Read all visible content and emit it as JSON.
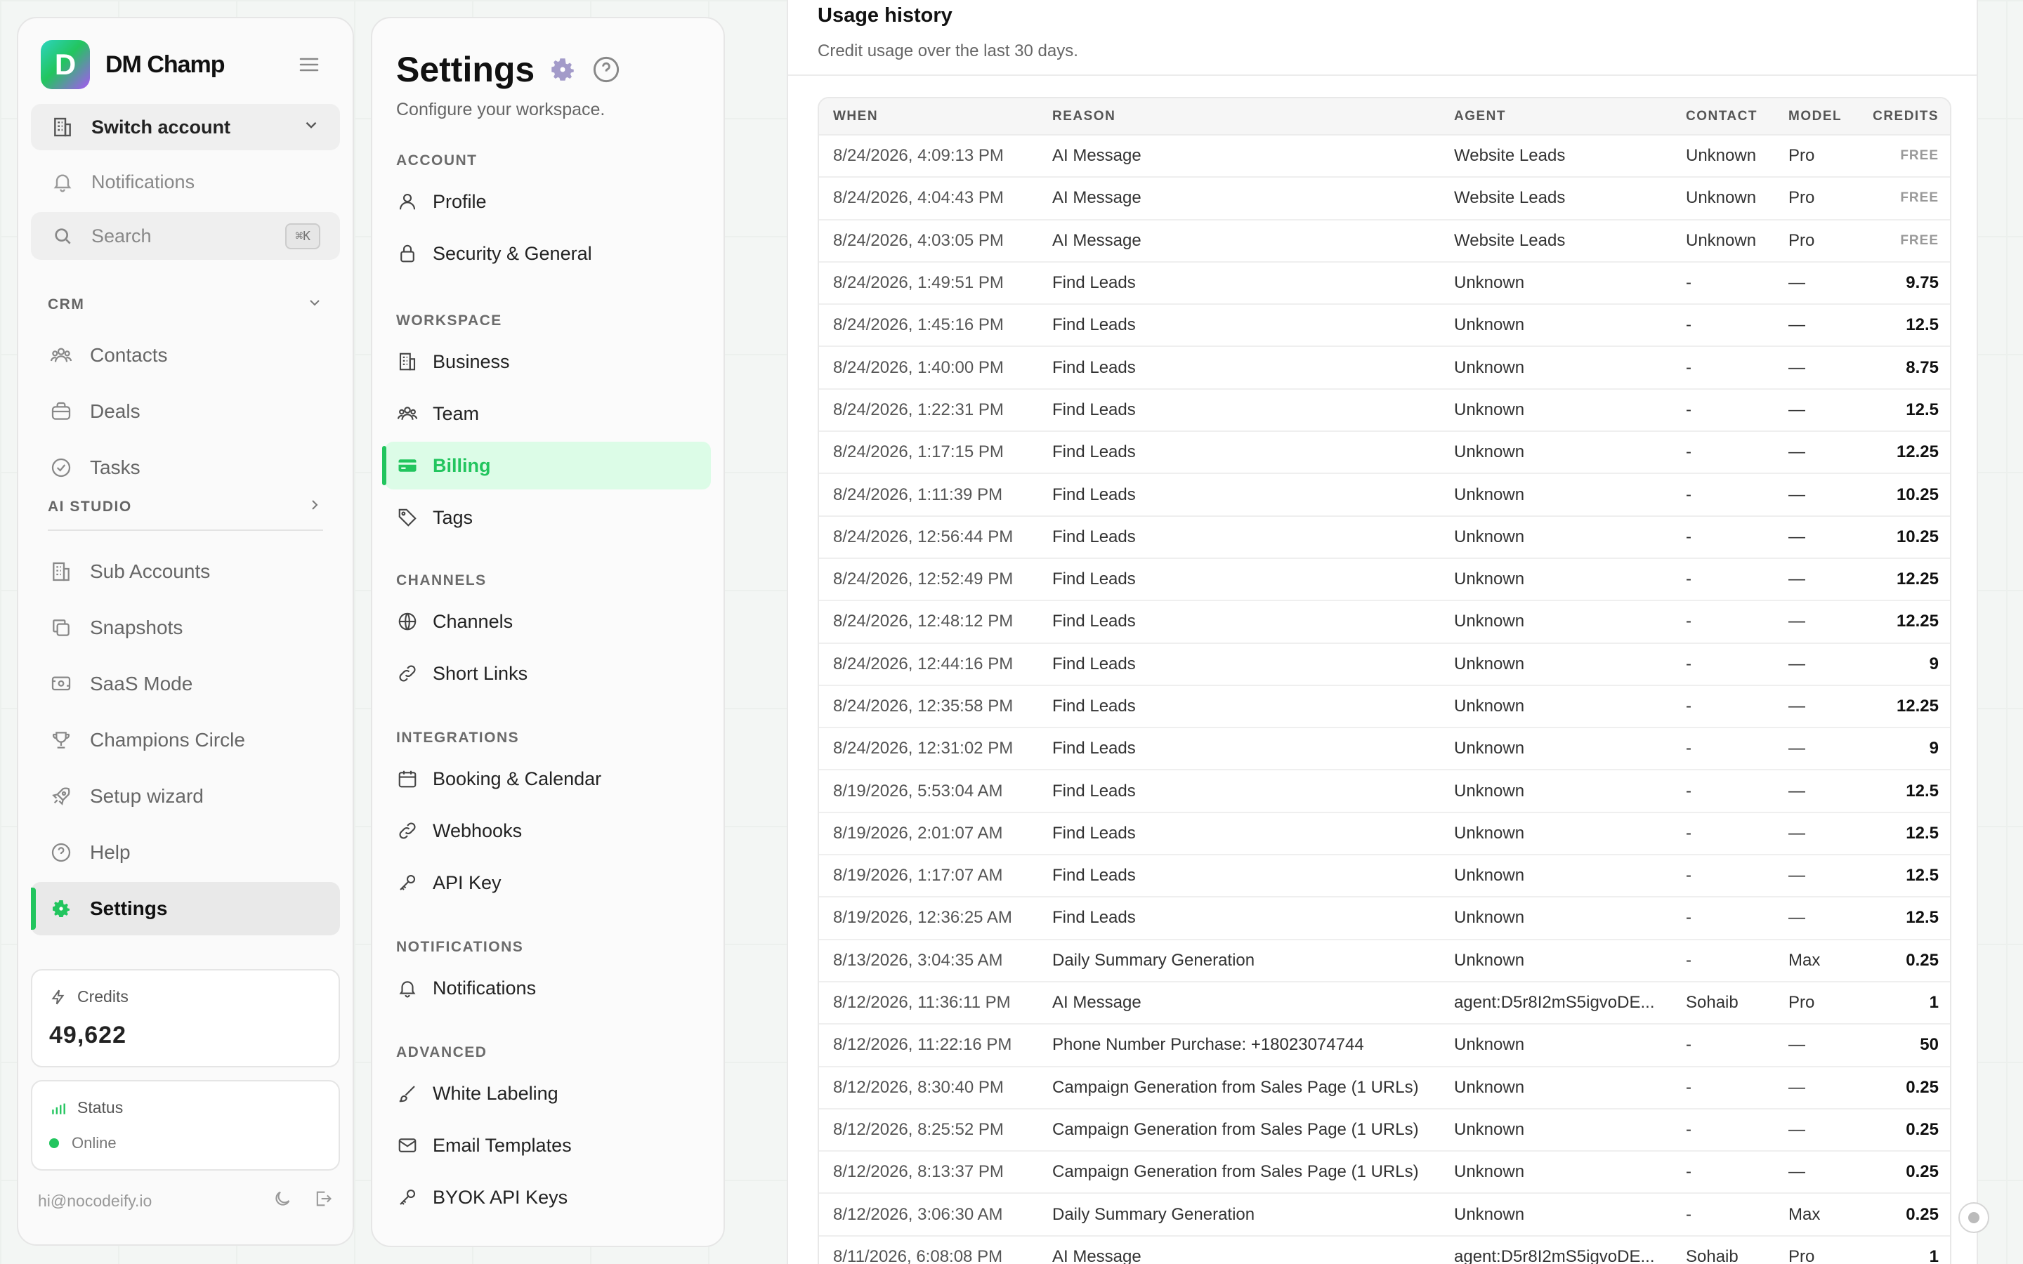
{
  "brand": {
    "name": "DM Champ",
    "logo_letter": "D"
  },
  "sidebar": {
    "switch_account": "Switch account",
    "notifications": "Notifications",
    "search_placeholder": "Search",
    "search_shortcut": "⌘K",
    "crm_label": "CRM",
    "crm_items": [
      {
        "label": "Contacts",
        "icon": "users-icon"
      },
      {
        "label": "Deals",
        "icon": "briefcase-icon"
      },
      {
        "label": "Tasks",
        "icon": "check-circle-icon"
      }
    ],
    "ai_studio_label": "AI STUDIO",
    "items": [
      {
        "label": "Sub Accounts",
        "icon": "building-icon"
      },
      {
        "label": "Snapshots",
        "icon": "copy-icon"
      },
      {
        "label": "SaaS Mode",
        "icon": "monitor-icon"
      },
      {
        "label": "Champions Circle",
        "icon": "trophy-icon"
      },
      {
        "label": "Setup wizard",
        "icon": "rocket-icon"
      },
      {
        "label": "Help",
        "icon": "help-circle-icon"
      },
      {
        "label": "Settings",
        "icon": "gear-icon",
        "active": true
      }
    ],
    "credits_label": "Credits",
    "credits_value": "49,622",
    "status_label": "Status",
    "status_value": "Online",
    "user_email": "hi@nocodeify.io"
  },
  "settings": {
    "title": "Settings",
    "subtitle": "Configure your workspace.",
    "groups": [
      {
        "label": "ACCOUNT",
        "items": [
          {
            "label": "Profile",
            "icon": "user-icon"
          },
          {
            "label": "Security & General",
            "icon": "lock-icon"
          }
        ]
      },
      {
        "label": "WORKSPACE",
        "items": [
          {
            "label": "Business",
            "icon": "building-icon"
          },
          {
            "label": "Team",
            "icon": "users-icon"
          },
          {
            "label": "Billing",
            "icon": "credit-card-icon",
            "active": true
          },
          {
            "label": "Tags",
            "icon": "tag-icon"
          }
        ]
      },
      {
        "label": "CHANNELS",
        "items": [
          {
            "label": "Channels",
            "icon": "globe-icon"
          },
          {
            "label": "Short Links",
            "icon": "link-icon"
          }
        ]
      },
      {
        "label": "INTEGRATIONS",
        "items": [
          {
            "label": "Booking & Calendar",
            "icon": "calendar-icon"
          },
          {
            "label": "Webhooks",
            "icon": "link-icon"
          },
          {
            "label": "API Key",
            "icon": "key-icon"
          }
        ]
      },
      {
        "label": "NOTIFICATIONS",
        "items": [
          {
            "label": "Notifications",
            "icon": "bell-icon"
          }
        ]
      },
      {
        "label": "ADVANCED",
        "items": [
          {
            "label": "White Labeling",
            "icon": "brush-icon"
          },
          {
            "label": "Email Templates",
            "icon": "mail-icon"
          },
          {
            "label": "BYOK API Keys",
            "icon": "key-icon"
          }
        ]
      }
    ]
  },
  "usage": {
    "title": "Usage history",
    "subtitle": "Credit usage over the last 30 days.",
    "columns": [
      "WHEN",
      "REASON",
      "AGENT",
      "CONTACT",
      "MODEL",
      "CREDITS"
    ],
    "rows": [
      [
        "8/24/2026, 4:09:13 PM",
        "AI Message",
        "Website Leads",
        "Unknown",
        "Pro",
        "FREE"
      ],
      [
        "8/24/2026, 4:04:43 PM",
        "AI Message",
        "Website Leads",
        "Unknown",
        "Pro",
        "FREE"
      ],
      [
        "8/24/2026, 4:03:05 PM",
        "AI Message",
        "Website Leads",
        "Unknown",
        "Pro",
        "FREE"
      ],
      [
        "8/24/2026, 1:49:51 PM",
        "Find Leads",
        "Unknown",
        "-",
        "—",
        "9.75"
      ],
      [
        "8/24/2026, 1:45:16 PM",
        "Find Leads",
        "Unknown",
        "-",
        "—",
        "12.5"
      ],
      [
        "8/24/2026, 1:40:00 PM",
        "Find Leads",
        "Unknown",
        "-",
        "—",
        "8.75"
      ],
      [
        "8/24/2026, 1:22:31 PM",
        "Find Leads",
        "Unknown",
        "-",
        "—",
        "12.5"
      ],
      [
        "8/24/2026, 1:17:15 PM",
        "Find Leads",
        "Unknown",
        "-",
        "—",
        "12.25"
      ],
      [
        "8/24/2026, 1:11:39 PM",
        "Find Leads",
        "Unknown",
        "-",
        "—",
        "10.25"
      ],
      [
        "8/24/2026, 12:56:44 PM",
        "Find Leads",
        "Unknown",
        "-",
        "—",
        "10.25"
      ],
      [
        "8/24/2026, 12:52:49 PM",
        "Find Leads",
        "Unknown",
        "-",
        "—",
        "12.25"
      ],
      [
        "8/24/2026, 12:48:12 PM",
        "Find Leads",
        "Unknown",
        "-",
        "—",
        "12.25"
      ],
      [
        "8/24/2026, 12:44:16 PM",
        "Find Leads",
        "Unknown",
        "-",
        "—",
        "9"
      ],
      [
        "8/24/2026, 12:35:58 PM",
        "Find Leads",
        "Unknown",
        "-",
        "—",
        "12.25"
      ],
      [
        "8/24/2026, 12:31:02 PM",
        "Find Leads",
        "Unknown",
        "-",
        "—",
        "9"
      ],
      [
        "8/19/2026, 5:53:04 AM",
        "Find Leads",
        "Unknown",
        "-",
        "—",
        "12.5"
      ],
      [
        "8/19/2026, 2:01:07 AM",
        "Find Leads",
        "Unknown",
        "-",
        "—",
        "12.5"
      ],
      [
        "8/19/2026, 1:17:07 AM",
        "Find Leads",
        "Unknown",
        "-",
        "—",
        "12.5"
      ],
      [
        "8/19/2026, 12:36:25 AM",
        "Find Leads",
        "Unknown",
        "-",
        "—",
        "12.5"
      ],
      [
        "8/13/2026, 3:04:35 AM",
        "Daily Summary Generation",
        "Unknown",
        "-",
        "Max",
        "0.25"
      ],
      [
        "8/12/2026, 11:36:11 PM",
        "AI Message",
        "agent:D5r8I2mS5igvoDE...",
        "Sohaib",
        "Pro",
        "1"
      ],
      [
        "8/12/2026, 11:22:16 PM",
        "Phone Number Purchase: +18023074744",
        "Unknown",
        "-",
        "—",
        "50"
      ],
      [
        "8/12/2026, 8:30:40 PM",
        "Campaign Generation from Sales Page (1 URLs)",
        "Unknown",
        "-",
        "—",
        "0.25"
      ],
      [
        "8/12/2026, 8:25:52 PM",
        "Campaign Generation from Sales Page (1 URLs)",
        "Unknown",
        "-",
        "—",
        "0.25"
      ],
      [
        "8/12/2026, 8:13:37 PM",
        "Campaign Generation from Sales Page (1 URLs)",
        "Unknown",
        "-",
        "—",
        "0.25"
      ],
      [
        "8/12/2026, 3:06:30 AM",
        "Daily Summary Generation",
        "Unknown",
        "-",
        "Max",
        "0.25"
      ],
      [
        "8/11/2026, 6:08:08 PM",
        "AI Message",
        "agent:D5r8I2mS5igvoDE...",
        "Sohaib",
        "Pro",
        "1"
      ]
    ]
  },
  "colors": {
    "accent": "#22c55e",
    "accent_bg": "#dcfce7"
  }
}
